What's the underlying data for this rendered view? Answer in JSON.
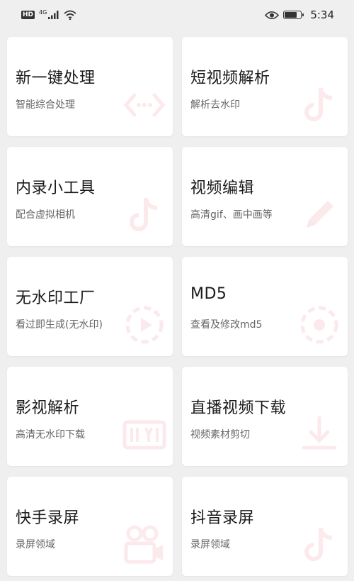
{
  "status_bar": {
    "hd": "HD",
    "network": "4G",
    "time": "5:34"
  },
  "accent_color": "#e8314f",
  "cards": [
    {
      "title": "新一键处理",
      "subtitle": "智能综合处理",
      "icon": "code-icon"
    },
    {
      "title": "短视频解析",
      "subtitle": "解析去水印",
      "icon": "tiktok-icon"
    },
    {
      "title": "内录小工具",
      "subtitle": "配合虚拟相机",
      "icon": "tiktok-icon"
    },
    {
      "title": "视频编辑",
      "subtitle": "高清gif、画中画等",
      "icon": "pencil-icon"
    },
    {
      "title": "无水印工厂",
      "subtitle": "看过即生成(无水印)",
      "icon": "play-circle-icon"
    },
    {
      "title": "MD5",
      "subtitle": "查看及修改md5",
      "icon": "target-icon"
    },
    {
      "title": "影视解析",
      "subtitle": "高清无水印下载",
      "icon": "iqiyi-icon"
    },
    {
      "title": "直播视频下载",
      "subtitle": "视频素材剪切",
      "icon": "download-icon"
    },
    {
      "title": "快手录屏",
      "subtitle": "录屏领域",
      "icon": "video-camera-icon"
    },
    {
      "title": "抖音录屏",
      "subtitle": "录屏领域",
      "icon": "tiktok-icon"
    }
  ]
}
